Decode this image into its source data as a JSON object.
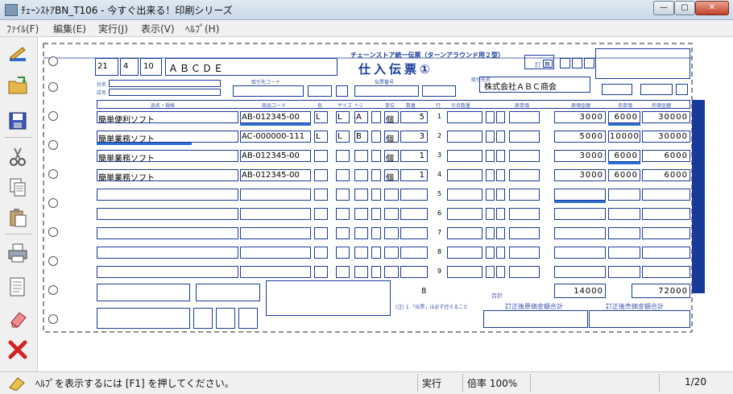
{
  "window": {
    "title": "ﾁｪｰﾝｽﾄｱBN_T106 - 今すぐ出来る！印刷シリーズ",
    "minimize_glyph": "—",
    "maximize_glyph": "▢",
    "close_glyph": "✕"
  },
  "menu": [
    "ﾌｧｲﾙ(F)",
    "編集(E)",
    "実行(J)",
    "表示(V)",
    "ﾍﾙﾌﾟ(H)"
  ],
  "toolbar": [
    "setup-icon",
    "open-icon",
    "save-icon",
    "cut-icon",
    "copy-icon",
    "paste-icon",
    "print-icon",
    "preview-icon",
    "eraser-icon",
    "delete-icon"
  ],
  "form": {
    "title_small": "チェーンストア統一伝票（ターンアラウンド用２型）",
    "title_large": "仕入伝票①",
    "header": {
      "code1": "21",
      "code2": "4",
      "code3": "10",
      "store": "ＡＢＣＤＥ",
      "supplier": "株式会社ＡＢＣ商会",
      "label_shamei": "社名",
      "label_tenmei": "店名",
      "label_torihiki": "取引先コード",
      "label_denpyo": "伝票番号",
      "label_torihikisaki": "取引先名",
      "label_teisei1": "訂",
      "label_teisei2": "無"
    },
    "columns": [
      "品名・規格",
      "商品コード",
      "色",
      "サイズ",
      "ｹｰｽ",
      "単位",
      "数量",
      "行",
      "引合数量",
      "原単価",
      "原価金額",
      "売単価",
      "売価金額"
    ],
    "rows": [
      {
        "name": "簡単便利ソフト",
        "code": "AB-012345-00",
        "s1": "L",
        "s2": "L",
        "s3": "A",
        "unit": "個",
        "qty": "5",
        "line": "1",
        "amount": "3000",
        "unit_price": "6000",
        "retail": "30000"
      },
      {
        "name": "簡単業務ソフト",
        "code": "AC-000000-111",
        "s1": "L",
        "s2": "L",
        "s3": "B",
        "unit": "個",
        "qty": "3",
        "line": "2",
        "amount": "5000",
        "unit_price": "10000",
        "retail": "30000"
      },
      {
        "name": "簡単業務ソフト",
        "code": "AB-012345-00",
        "s1": "",
        "s2": "",
        "s3": "",
        "unit": "個",
        "qty": "1",
        "line": "3",
        "amount": "3000",
        "unit_price": "6000",
        "retail": "6000"
      },
      {
        "name": "簡単業務ソフト",
        "code": "AB-012345-00",
        "s1": "",
        "s2": "",
        "s3": "",
        "unit": "個",
        "qty": "1",
        "line": "4",
        "amount": "3000",
        "unit_price": "6000",
        "retail": "6000"
      }
    ],
    "empty_line_numbers": [
      "5",
      "6",
      "7",
      "8",
      "9"
    ],
    "totals": {
      "qty": "8",
      "cost": "14000",
      "retail": "72000",
      "label_total": "合計",
      "label_corrected_cost": "訂正後原価金額合計",
      "label_corrected_retail": "訂正後売価金額合計",
      "note": "(注) 1.「伝票」は必ず控えること"
    }
  },
  "status": {
    "help": "ﾍﾙﾌﾟを表示するには [F1] を押してください。",
    "mode": "実行",
    "zoom": "倍率 100%",
    "page": "1/20"
  }
}
